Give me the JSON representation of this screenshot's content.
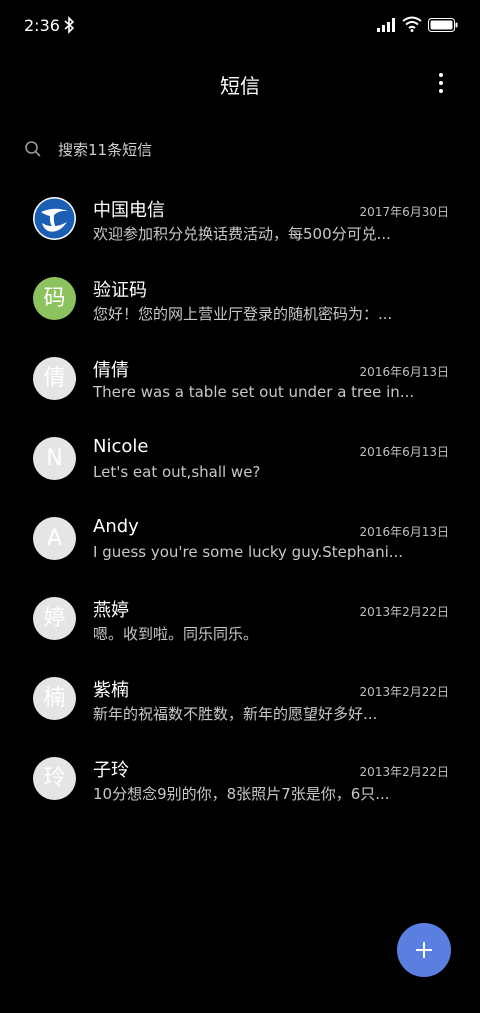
{
  "status_bar": {
    "time": "2:36"
  },
  "header": {
    "title": "短信"
  },
  "search": {
    "placeholder": "搜索11条短信"
  },
  "messages": [
    {
      "name": "中国电信",
      "preview": "欢迎参加积分兑换话费活动，每500分可兑...",
      "date": "2017年6月30日",
      "avatar": "",
      "avatar_type": "logo"
    },
    {
      "name": "验证码",
      "preview": "您好！您的网上营业厅登录的随机密码为：...",
      "date": "",
      "avatar": "码",
      "avatar_type": "green"
    },
    {
      "name": "倩倩",
      "preview": "There was a table set out under a tree in...",
      "date": "2016年6月13日",
      "avatar": "倩",
      "avatar_type": "gray"
    },
    {
      "name": "Nicole",
      "preview": "Let's eat out,shall we?",
      "date": "2016年6月13日",
      "avatar": "N",
      "avatar_type": "gray"
    },
    {
      "name": "Andy",
      "preview": "I guess you're some lucky guy.Stephani...",
      "date": "2016年6月13日",
      "avatar": "A",
      "avatar_type": "gray"
    },
    {
      "name": "燕婷",
      "preview": "嗯。收到啦。同乐同乐。",
      "date": "2013年2月22日",
      "avatar": "婷",
      "avatar_type": "gray"
    },
    {
      "name": "紫楠",
      "preview": "新年的祝福数不胜数，新年的愿望好多好...",
      "date": "2013年2月22日",
      "avatar": "楠",
      "avatar_type": "gray"
    },
    {
      "name": "子玲",
      "preview": "10分想念9别的你，8张照片7张是你，6只...",
      "date": "2013年2月22日",
      "avatar": "玲",
      "avatar_type": "gray"
    }
  ],
  "colors": {
    "background": "#000000",
    "fab": "#5b7fe0",
    "avatar_green": "#8cc35f",
    "avatar_gray": "#e5e5e5",
    "telecom_blue": "#1a5fb4"
  },
  "icons": {
    "bluetooth": "bluetooth-icon",
    "signal": "signal-icon",
    "wifi": "wifi-icon",
    "battery": "battery-icon",
    "menu": "more-vertical-icon",
    "search": "search-icon",
    "fab": "plus-icon"
  }
}
